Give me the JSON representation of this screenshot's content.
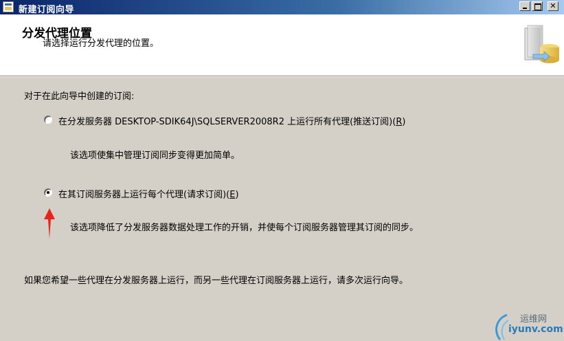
{
  "window": {
    "title": "新建订阅向导",
    "icon": "wizard-app-icon",
    "controls": [
      "minimize-icon",
      "maximize-icon",
      "close-icon"
    ]
  },
  "header": {
    "title": "分发代理位置",
    "subtitle": "请选择运行分发代理的位置。",
    "graphic": "database-wizard-icon"
  },
  "content": {
    "intro": "对于在此向导中创建的订阅:",
    "options": [
      {
        "label_prefix": "在分发服务器 DESKTOP-SDIK64J\\SQLSERVER2008R2 上运行所有代理(推送订阅)(",
        "accelerator": "R",
        "label_suffix": ")",
        "checked": false,
        "description": "该选项使集中管理订阅同步变得更加简单。"
      },
      {
        "label_prefix": "在其订阅服务器上运行每个代理(请求订阅)(",
        "accelerator": "E",
        "label_suffix": ")",
        "checked": true,
        "description": "该选项降低了分发服务器数据处理工作的开销，并使每个订阅服务器管理其订阅的同步。"
      }
    ],
    "footer_note": "如果您希望一些代理在分发服务器上运行，而另一些代理在订阅服务器上运行，请多次运行向导。"
  },
  "annotation": {
    "arrow_color": "#e8231c"
  },
  "watermark": {
    "line1": "运维网",
    "line2": "iyunv.com"
  },
  "colors": {
    "titlebar_start": "#0a246a",
    "dialog_bg": "#d4d0c8",
    "header_bg": "#ffffff"
  }
}
